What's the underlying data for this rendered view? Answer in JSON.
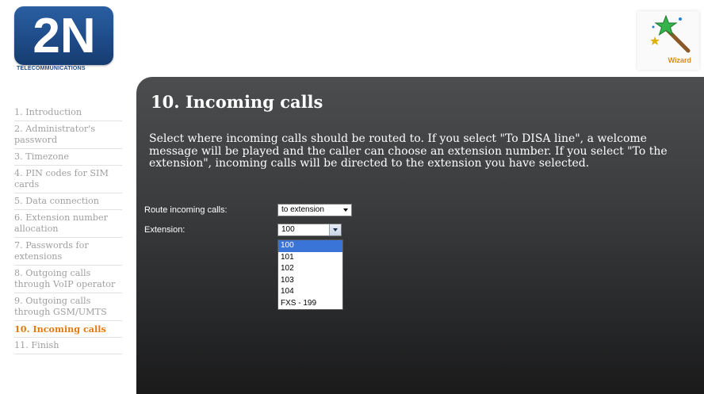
{
  "brand": {
    "logo_text": "2N",
    "tagline": "TELECOMMUNICATIONS"
  },
  "wizard": {
    "label": "Wizard"
  },
  "nav": {
    "items": [
      {
        "label": "1. Introduction",
        "active": false
      },
      {
        "label": "2. Administrator's password",
        "active": false
      },
      {
        "label": "3. Timezone",
        "active": false
      },
      {
        "label": "4. PIN codes for SIM cards",
        "active": false
      },
      {
        "label": "5. Data connection",
        "active": false
      },
      {
        "label": "6. Extension number allocation",
        "active": false
      },
      {
        "label": "7. Passwords for extensions",
        "active": false
      },
      {
        "label": "8. Outgoing calls through VoIP operator",
        "active": false
      },
      {
        "label": "9. Outgoing calls through GSM/UMTS",
        "active": false
      },
      {
        "label": "10. Incoming calls",
        "active": true
      },
      {
        "label": "11. Finish",
        "active": false
      }
    ]
  },
  "main": {
    "title": "10. Incoming calls",
    "description": "Select where incoming calls should be routed to. If you select \"To DISA line\", a welcome message will be played and the caller can choose an extension number. If you select \"To the extension\", incoming calls will be directed to the extension you have selected.",
    "route": {
      "label": "Route incoming calls:",
      "value": "to extension"
    },
    "extension": {
      "label": "Extension:",
      "value": "100",
      "options": [
        "100",
        "101",
        "102",
        "103",
        "104",
        "FXS - 199"
      ],
      "highlighted": "100"
    }
  },
  "colors": {
    "accent": "#e07c0f",
    "nav_text": "#a0a0a0",
    "panel_bg": "#3a3c3e",
    "logo_blue": "#1d4a86",
    "selection": "#3b74d8"
  }
}
